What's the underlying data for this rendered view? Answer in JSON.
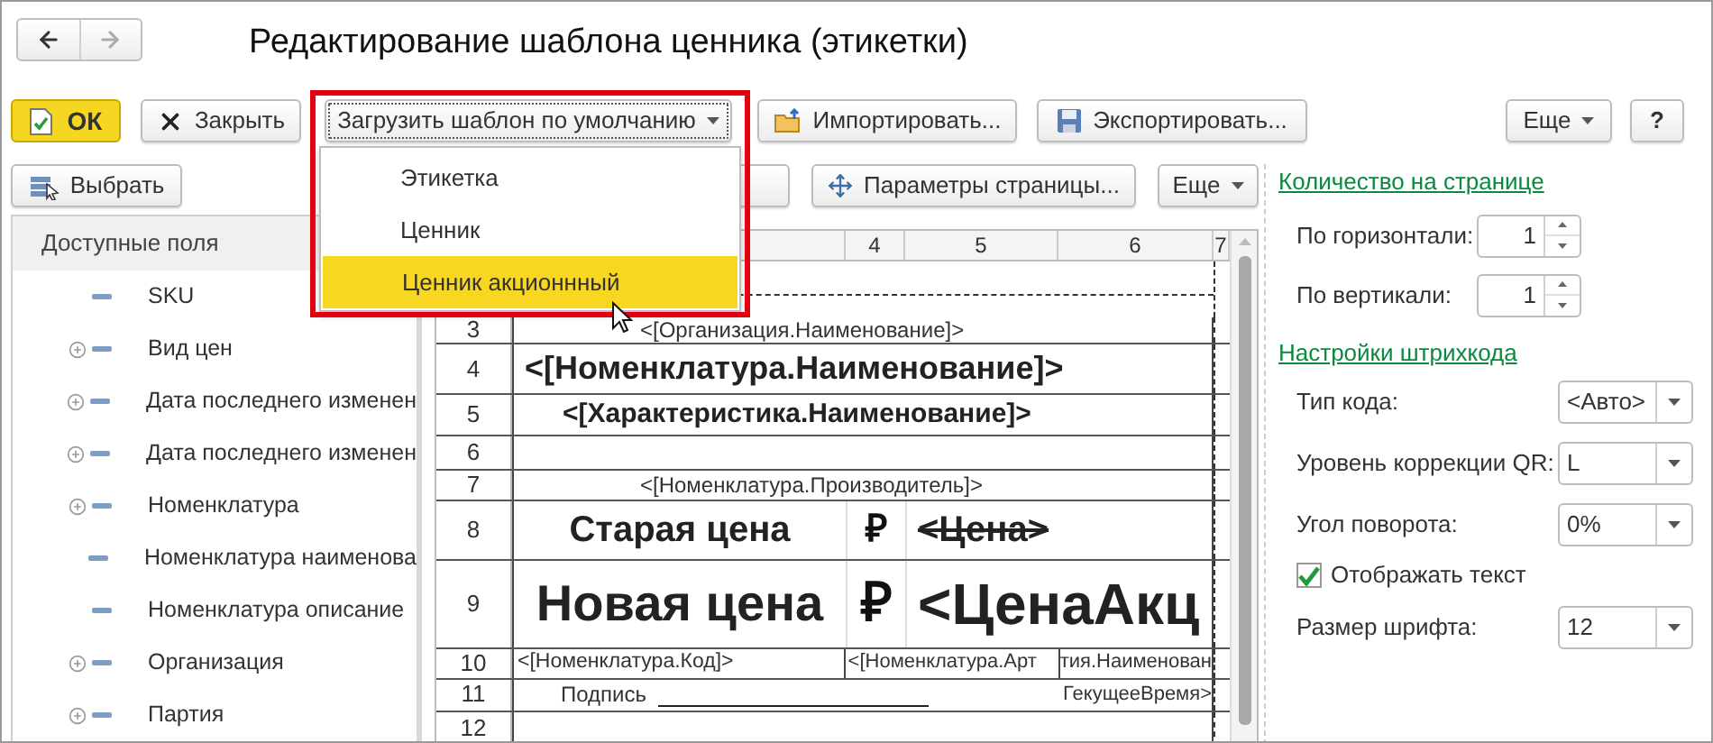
{
  "window": {
    "title": "Редактирование шаблона ценника (этикетки)"
  },
  "toolbar": {
    "ok": "ОК",
    "close": "Закрыть",
    "load_default": "Загрузить шаблон по умолчанию",
    "import": "Импортировать...",
    "export": "Экспортировать...",
    "more": "Еще",
    "help": "?"
  },
  "load_menu": {
    "open": true,
    "items": [
      {
        "label": "Этикетка",
        "selected": false
      },
      {
        "label": "Ценник",
        "selected": false
      },
      {
        "label": "Ценник акционнный",
        "selected": true
      }
    ]
  },
  "fields_panel": {
    "select_button": "Выбрать",
    "header": "Доступные поля",
    "items": [
      {
        "label": "SKU",
        "expandable": false
      },
      {
        "label": "Вид цен",
        "expandable": true
      },
      {
        "label": "Дата последнего изменен",
        "expandable": true
      },
      {
        "label": "Дата последнего изменен",
        "expandable": true
      },
      {
        "label": "Номенклатура",
        "expandable": true
      },
      {
        "label": "Номенклатура наименова",
        "expandable": false
      },
      {
        "label": "Номенклатура описание",
        "expandable": false
      },
      {
        "label": "Организация",
        "expandable": true
      },
      {
        "label": "Партия",
        "expandable": true
      }
    ]
  },
  "template_toolbar": {
    "page_settings": "Параметры страницы...",
    "more": "Еще"
  },
  "sheet": {
    "columns": [
      "4",
      "5",
      "6",
      "7"
    ],
    "rows": [
      {
        "number": "3",
        "kind": "caption",
        "text": "<[Организация.Наименование]>"
      },
      {
        "number": "4",
        "kind": "heading",
        "text": "<[Номенклатура.Наименование]>"
      },
      {
        "number": "5",
        "kind": "subheading",
        "text": "<[Характеристика.Наименование]>"
      },
      {
        "number": "6",
        "kind": "empty"
      },
      {
        "number": "7",
        "kind": "caption",
        "text": "<[Номенклатура.Производитель]>"
      },
      {
        "number": "8",
        "kind": "old-price",
        "label": "Старая цена",
        "currency": "₽",
        "value": "<Цена>"
      },
      {
        "number": "9",
        "kind": "new-price",
        "label": "Новая цена",
        "currency": "₽",
        "value": "<ЦенаАкц"
      },
      {
        "number": "10",
        "kind": "codes",
        "cells": [
          "<[Номенклатура.Код]>",
          "<[Номенклатура.Арт",
          "тия.Наименован"
        ]
      },
      {
        "number": "11",
        "kind": "signature",
        "label": "Подпись",
        "time": "ГекущееВремя>"
      },
      {
        "number": "12",
        "kind": "empty"
      }
    ]
  },
  "settings": {
    "per_page": {
      "title": "Количество на странице",
      "horizontal_label": "По горизонтали:",
      "horizontal": "1",
      "vertical_label": "По вертикали:",
      "vertical": "1"
    },
    "barcode": {
      "title": "Настройки штрихкода",
      "fields": [
        {
          "label": "Тип кода:",
          "value": "<Авто>"
        },
        {
          "label": "Уровень коррекции QR:",
          "value": "L"
        },
        {
          "label": "Угол поворота:",
          "value": "0%"
        }
      ],
      "show_text": {
        "label": "Отображать текст",
        "checked": true
      },
      "font_size": {
        "label": "Размер шрифта:",
        "value": "12"
      }
    }
  }
}
